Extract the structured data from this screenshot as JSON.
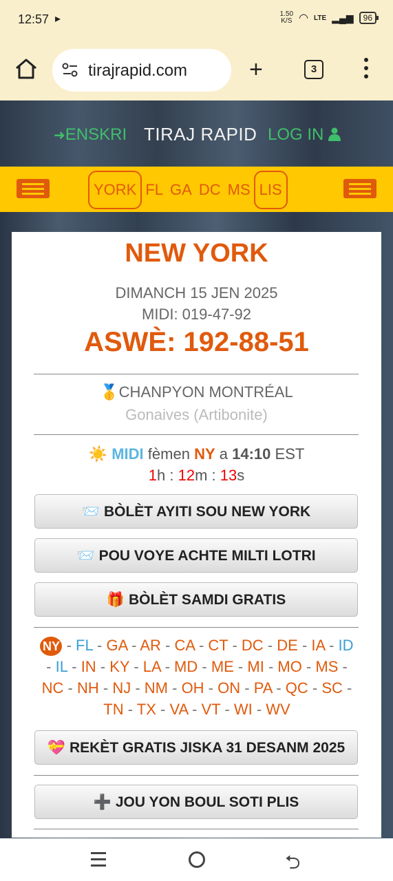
{
  "status_bar": {
    "time": "12:57",
    "speed_top": "1.50",
    "speed_bottom": "K/S",
    "network": "LTE",
    "battery": "96"
  },
  "browser": {
    "url": "tirajrapid.com",
    "tab_count": "3"
  },
  "header": {
    "enskri": "ENSKRI",
    "brand": "TIRAJ RAPID",
    "login": "LOG IN"
  },
  "nav": {
    "items": [
      "YORK",
      "FL",
      "GA",
      "DC",
      "MS",
      "LIS"
    ]
  },
  "result": {
    "state": "NEW YORK",
    "date": "DIMANCH 15 JEN 2025",
    "midi": "MIDI: 019-47-92",
    "aswe": "ASWÈ: 192-88-51"
  },
  "champion": {
    "label": "CHANPYON MONTRÉAL",
    "city": "Gonaives (Artibonite)"
  },
  "next_draw": {
    "session": "MIDI",
    "text1": "fèmen",
    "state": "NY",
    "text2": "a",
    "time": "14:10",
    "tz": "EST",
    "h": "1",
    "m": "12",
    "s": "13"
  },
  "buttons": {
    "b1": "BÒLÈT AYITI SOU NEW YORK",
    "b2": "POU VOYE ACHTE MILTI LOTRI",
    "b3": "BÒLÈT SAMDI GRATIS",
    "b4": "REKÈT GRATIS JISKA 31 DESANM 2025",
    "b5": "JOU YON BOUL SOTI PLIS"
  },
  "states": {
    "current": "NY",
    "blue": [
      "FL",
      "ID",
      "IL"
    ],
    "list": [
      "FL",
      "GA",
      "AR",
      "CA",
      "CT",
      "DC",
      "DE",
      "IA",
      "ID",
      "IL",
      "IN",
      "KY",
      "LA",
      "MD",
      "ME",
      "MI",
      "MO",
      "MS",
      "NC",
      "NH",
      "NJ",
      "NM",
      "OH",
      "ON",
      "PA",
      "QC",
      "SC",
      "TN",
      "TX",
      "VA",
      "VT",
      "WI",
      "WV"
    ]
  }
}
